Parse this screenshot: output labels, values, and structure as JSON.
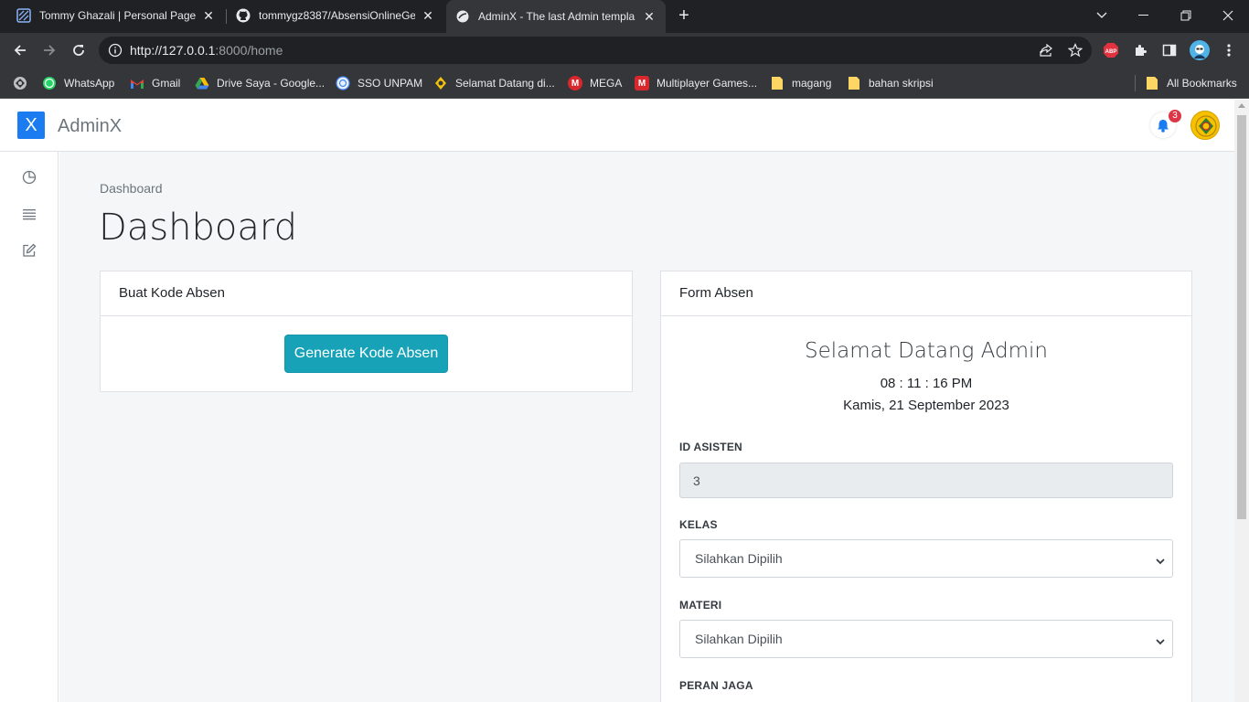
{
  "browser": {
    "tabs": [
      {
        "title": "Tommy Ghazali | Personal Pages",
        "icon": "site-logo-icon"
      },
      {
        "title": "tommygz8387/AbsensiOnlineGe",
        "icon": "github-icon"
      },
      {
        "title": "AdminX - The last Admin templa",
        "icon": "globe-icon",
        "active": true
      }
    ],
    "url_host": "http://127.0.0.1",
    "url_rest": ":8000/home",
    "bookmarks": [
      {
        "label": "WhatsApp",
        "icon": "whatsapp-icon",
        "color": "#25d366"
      },
      {
        "label": "Gmail",
        "icon": "gmail-icon",
        "color": "#ea4335"
      },
      {
        "label": "Drive Saya - Google...",
        "icon": "drive-icon",
        "color": "#34a853"
      },
      {
        "label": "SSO UNPAM",
        "icon": "sso-icon",
        "color": "#4285f4"
      },
      {
        "label": "Selamat Datang di...",
        "icon": "site-icon",
        "color": "#f4c20d"
      },
      {
        "label": "MEGA",
        "icon": "mega-icon",
        "color": "#d9272e"
      },
      {
        "label": "Multiplayer Games...",
        "icon": "games-icon",
        "color": "#d9272e"
      },
      {
        "label": "magang",
        "icon": "folder-icon",
        "color": "#fdd663"
      },
      {
        "label": "bahan skripsi",
        "icon": "folder-icon",
        "color": "#fdd663"
      },
      {
        "label": "All Bookmarks",
        "icon": "folder-icon",
        "color": "#fdd663"
      }
    ]
  },
  "app": {
    "brand_letter": "X",
    "brand_name": "AdminX",
    "notification_count": "3",
    "accent": "#1a7cf0",
    "button_color": "#17a2b8"
  },
  "page": {
    "breadcrumb": "Dashboard",
    "title": "Dashboard"
  },
  "kode_card": {
    "header": "Buat Kode Absen",
    "button": "Generate Kode Absen"
  },
  "form_card": {
    "header": "Form Absen",
    "welcome": "Selamat Datang Admin",
    "time": "08 : 11 : 16 PM",
    "date": "Kamis, 21 September 2023",
    "fields": {
      "id_asisten_label": "ID ASISTEN",
      "id_asisten_value": "3",
      "kelas_label": "KELAS",
      "kelas_value": "Silahkan Dipilih",
      "materi_label": "MATERI",
      "materi_value": "Silahkan Dipilih",
      "peran_label": "PERAN JAGA"
    }
  }
}
